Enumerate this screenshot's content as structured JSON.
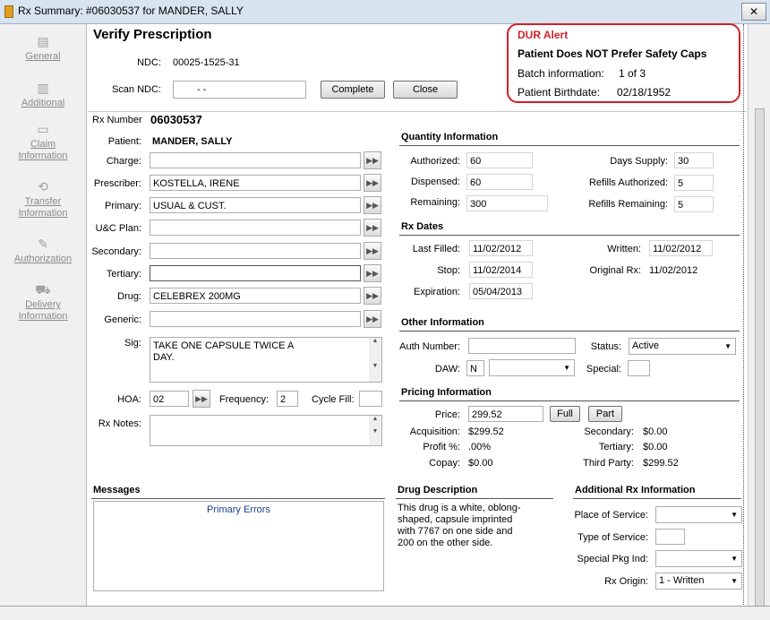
{
  "window": {
    "title": "Rx Summary: #06030537 for MANDER, SALLY",
    "close_label": "✕"
  },
  "nav": {
    "general": "General",
    "additional": "Additional",
    "claim": "Claim Information",
    "transfer": "Transfer Information",
    "authorization": "Authorization",
    "delivery": "Delivery Information"
  },
  "verify": {
    "heading": "Verify Prescription",
    "ndc_label": "NDC:",
    "ndc_value": "00025-1525-31",
    "scan_label": "Scan NDC:",
    "scan_value": "-   -",
    "complete_label": "Complete",
    "close_label": "Close"
  },
  "dur": {
    "title": "DUR Alert",
    "message": "Patient Does NOT Prefer Safety Caps",
    "batch_label": "Batch information:",
    "batch_value": "1 of 3",
    "birth_label": "Patient Birthdate:",
    "birth_value": "02/18/1952",
    "accent": "#d0202a"
  },
  "rx": {
    "number_label": "Rx Number",
    "number_value": "06030537",
    "patient_label": "Patient:",
    "patient_value": "MANDER, SALLY",
    "charge_label": "Charge:",
    "charge_value": "",
    "prescriber_label": "Prescriber:",
    "prescriber_value": "KOSTELLA, IRENE",
    "primary_label": "Primary:",
    "primary_value": "USUAL & CUST.",
    "uc_label": "U&C Plan:",
    "uc_value": "",
    "secondary_label": "Secondary:",
    "secondary_value": "",
    "tertiary_label": "Tertiary:",
    "tertiary_value": "",
    "drug_label": "Drug:",
    "drug_value": "CELEBREX 200MG",
    "generic_label": "Generic:",
    "generic_value": "",
    "sig_label": "Sig:",
    "sig_line1": "TAKE ONE CAPSULE TWICE A",
    "sig_line2": "DAY.",
    "hoa_label": "HOA:",
    "hoa_value": "02",
    "frequency_label": "Frequency:",
    "frequency_value": "2",
    "cycle_label": "Cycle Fill:",
    "cycle_value": "",
    "notes_label": "Rx Notes:",
    "notes_value": ""
  },
  "quantity": {
    "heading": "Quantity Information",
    "authorized_label": "Authorized:",
    "authorized_value": "60",
    "dispensed_label": "Dispensed:",
    "dispensed_value": "60",
    "remaining_label": "Remaining:",
    "remaining_value": "300",
    "days_label": "Days Supply:",
    "days_value": "30",
    "refills_auth_label": "Refills Authorized:",
    "refills_auth_value": "5",
    "refills_rem_label": "Refills Remaining:",
    "refills_rem_value": "5"
  },
  "dates": {
    "heading": "Rx Dates",
    "last_label": "Last Filled:",
    "last_value": "11/02/2012",
    "stop_label": "Stop:",
    "stop_value": "11/02/2014",
    "exp_label": "Expiration:",
    "exp_value": "05/04/2013",
    "written_label": "Written:",
    "written_value": "11/02/2012",
    "orig_label": "Original Rx:",
    "orig_value": "11/02/2012"
  },
  "other": {
    "heading": "Other Information",
    "auth_label": "Auth Number:",
    "auth_value": "",
    "daw_label": "DAW:",
    "daw_value": "N",
    "daw_select": "",
    "status_label": "Status:",
    "status_value": "Active",
    "special_label": "Special:",
    "special_value": ""
  },
  "pricing": {
    "heading": "Pricing Information",
    "price_label": "Price:",
    "price_value": "299.52",
    "full_label": "Full",
    "part_label": "Part",
    "acq_label": "Acquisition:",
    "acq_value": "$299.52",
    "profit_label": "Profit %:",
    "profit_value": ".00%",
    "copay_label": "Copay:",
    "copay_value": "$0.00",
    "sec_label": "Secondary:",
    "sec_value": "$0.00",
    "ter_label": "Tertiary:",
    "ter_value": "$0.00",
    "third_label": "Third Party:",
    "third_value": "$299.52"
  },
  "messages": {
    "heading": "Messages",
    "link": "Primary Errors"
  },
  "drug_desc": {
    "heading": "Drug Description",
    "line1": "This drug is a white, oblong-",
    "line2": "shaped, capsule imprinted",
    "line3": "with 7767 on one side and",
    "line4": "200 on the other side."
  },
  "additional_rx": {
    "heading": "Additional Rx Information",
    "place_label": "Place of Service:",
    "place_value": "",
    "type_label": "Type of Service:",
    "type_value": "",
    "pkg_label": "Special Pkg Ind:",
    "pkg_value": "",
    "origin_label": "Rx Origin:",
    "origin_value": "1 - Written"
  }
}
